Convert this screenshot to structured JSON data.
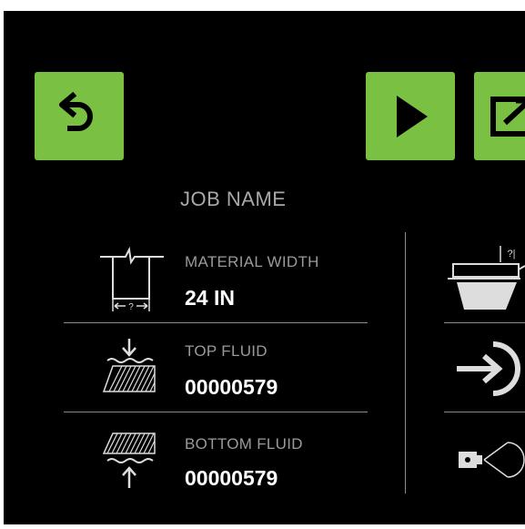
{
  "screen": {
    "job_name": "JOB NAME",
    "accent_color": "#7ac143",
    "background_color": "#000000"
  },
  "toolbar": {
    "back_icon": "return-arrow-icon",
    "play_icon": "play-icon",
    "export_icon": "export-icon"
  },
  "settings": [
    {
      "label": "MATERIAL WIDTH",
      "value": "24 IN",
      "icon": "material-width-icon"
    },
    {
      "label": "TOP FLUID",
      "value": "00000579",
      "icon": "top-fluid-icon"
    },
    {
      "label": "BOTTOM FLUID",
      "value": "00000579",
      "icon": "bottom-fluid-icon"
    }
  ],
  "right_column": {
    "icons": [
      "cutter-head-icon",
      "login-arrow-icon",
      "camera-projector-icon"
    ],
    "badge": "?|"
  },
  "material_icon_text": "?"
}
